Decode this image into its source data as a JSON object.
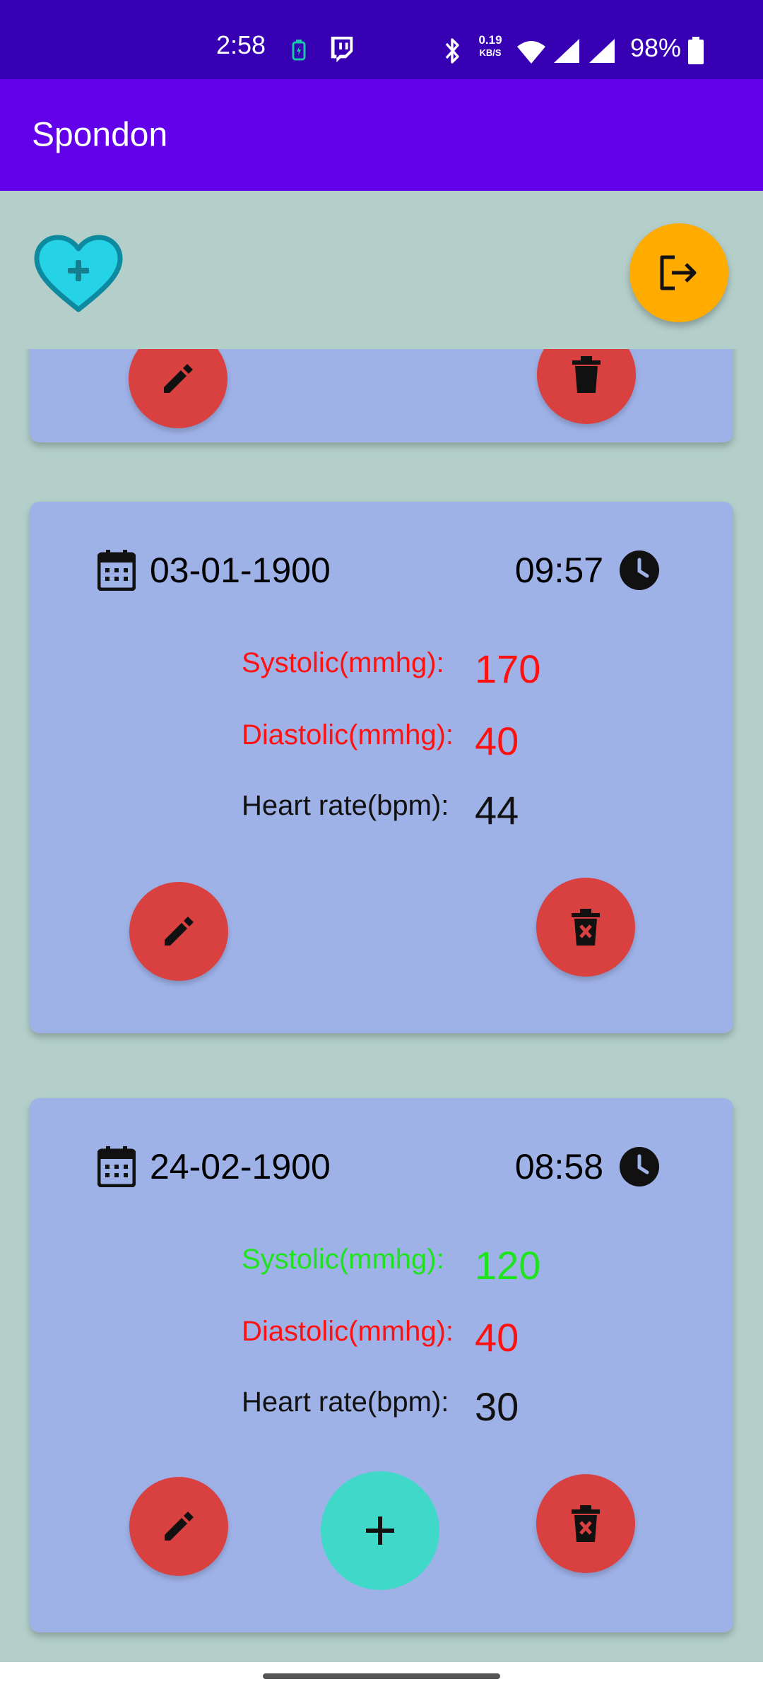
{
  "status_bar": {
    "time": "2:58",
    "network_speed": "0.19",
    "network_unit": "KB/S",
    "battery_percent": "98%"
  },
  "app_bar": {
    "title": "Spondon"
  },
  "icons": {
    "heart_add": "heart-add-icon",
    "logout": "logout-icon",
    "calendar": "calendar-icon",
    "clock": "clock-icon",
    "edit": "pencil-icon",
    "delete": "delete-icon",
    "add": "plus-icon"
  },
  "colors": {
    "status_bar": "#3700b3",
    "app_bar": "#6200ea",
    "background": "#b4cfca",
    "card": "#9fb2e8",
    "logout_button": "#ffab00",
    "action_button": "#d94040",
    "add_button": "#40d8c8",
    "alert_red": "#ff1111",
    "normal_green": "#1ee31e"
  },
  "records": [
    {
      "date": "03-01-1900",
      "time": "09:57",
      "systolic_label": "Systolic(mmhg):",
      "systolic_value": "170",
      "systolic_status": "high",
      "diastolic_label": "Diastolic(mmhg):",
      "diastolic_value": "40",
      "diastolic_status": "low",
      "heart_rate_label": "Heart rate(bpm):",
      "heart_rate_value": "44"
    },
    {
      "date": "24-02-1900",
      "time": "08:58",
      "systolic_label": "Systolic(mmhg):",
      "systolic_value": "120",
      "systolic_status": "normal",
      "diastolic_label": "Diastolic(mmhg):",
      "diastolic_value": "40",
      "diastolic_status": "low",
      "heart_rate_label": "Heart rate(bpm):",
      "heart_rate_value": "30"
    }
  ]
}
